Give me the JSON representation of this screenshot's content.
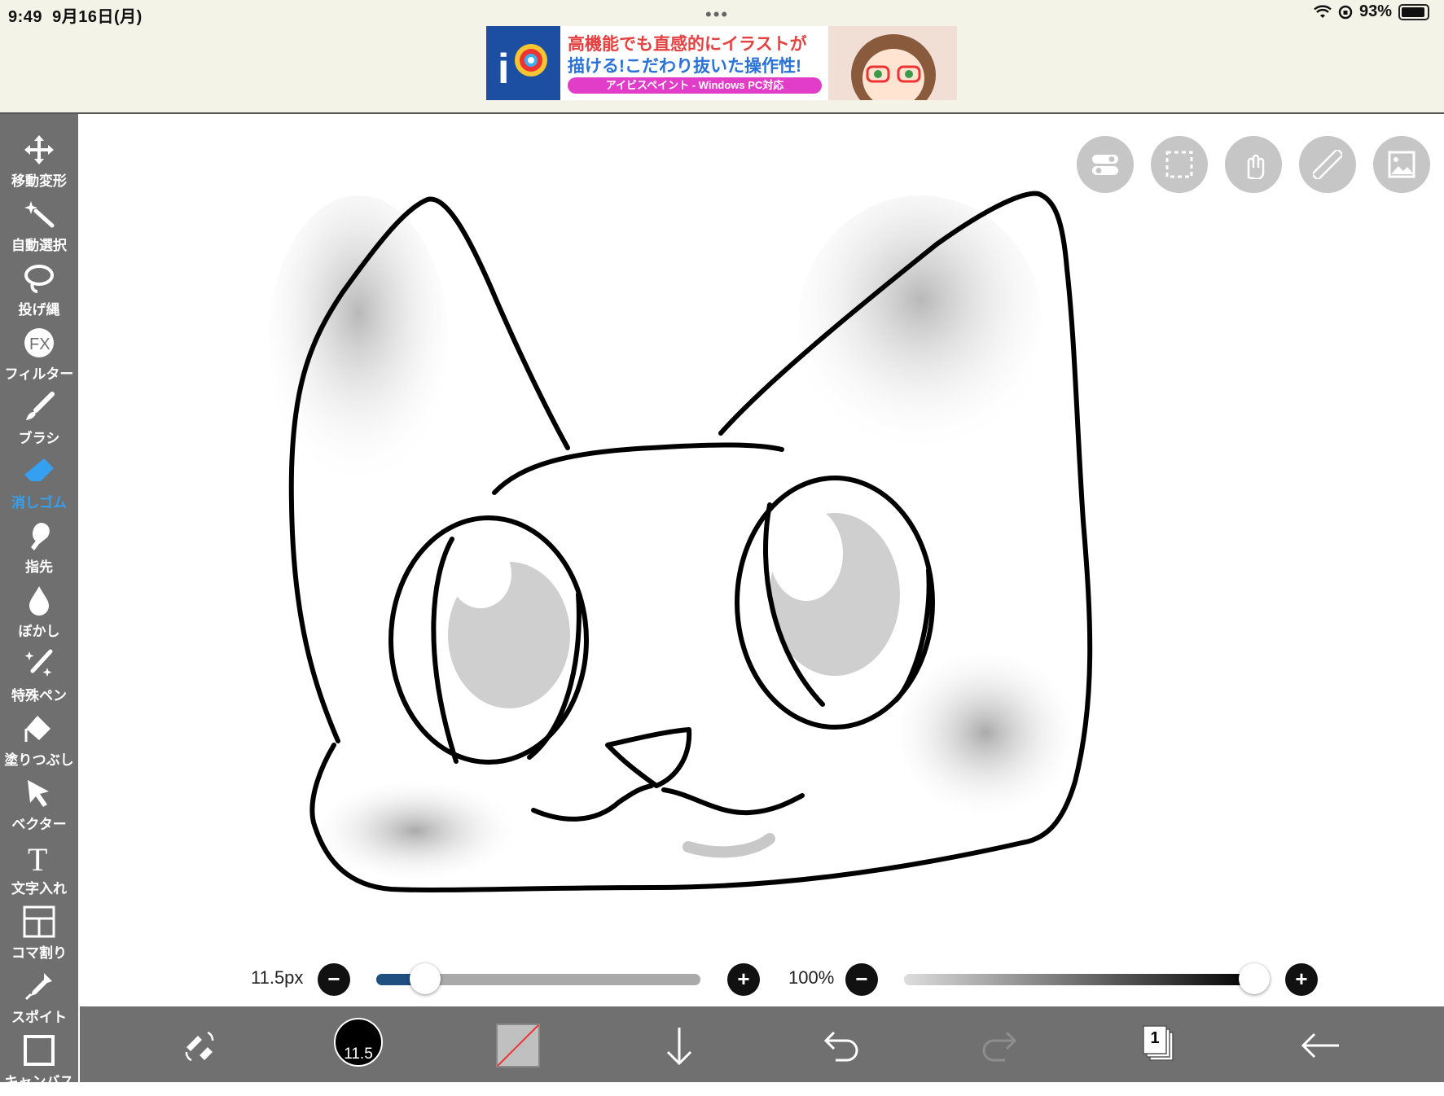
{
  "status": {
    "time": "9:49",
    "date": "9月16日(月)",
    "battery_text": "93%",
    "battery_level": 0.93
  },
  "ad": {
    "line1": "高機能でも直感的にイラストが",
    "line2": "描ける!こだわり抜いた操作性!",
    "line3": "アイビスペイント - Windows PC対応"
  },
  "tools": [
    {
      "label": "移動変形",
      "icon": "move-icon"
    },
    {
      "label": "自動選択",
      "icon": "magic-wand-icon"
    },
    {
      "label": "投げ縄",
      "icon": "lasso-icon"
    },
    {
      "label": "フィルター",
      "icon": "fx-icon"
    },
    {
      "label": "ブラシ",
      "icon": "brush-icon"
    },
    {
      "label": "消しゴム",
      "icon": "eraser-icon"
    },
    {
      "label": "指先",
      "icon": "smudge-icon"
    },
    {
      "label": "ぼかし",
      "icon": "blur-icon"
    },
    {
      "label": "特殊ペン",
      "icon": "special-pen-icon"
    },
    {
      "label": "塗りつぶし",
      "icon": "fill-icon"
    },
    {
      "label": "ベクター",
      "icon": "vector-icon"
    },
    {
      "label": "文字入れ",
      "icon": "text-icon"
    },
    {
      "label": "コマ割り",
      "icon": "frame-divider-icon"
    },
    {
      "label": "スポイト",
      "icon": "eyedropper-icon"
    },
    {
      "label": "キャンバス",
      "icon": "canvas-icon"
    }
  ],
  "active_tool": "消しゴム",
  "brush": {
    "size_label": "11.5px",
    "size_value": 11.5,
    "size_fraction": 0.15,
    "opacity_label": "100%",
    "opacity_fraction": 1.0
  },
  "brush_badge": "11.5",
  "layers_count": "1",
  "colors": {
    "toolbar": "#6f6f6f",
    "active": "#36a0f0",
    "slider_fill": "#1e4f80"
  }
}
